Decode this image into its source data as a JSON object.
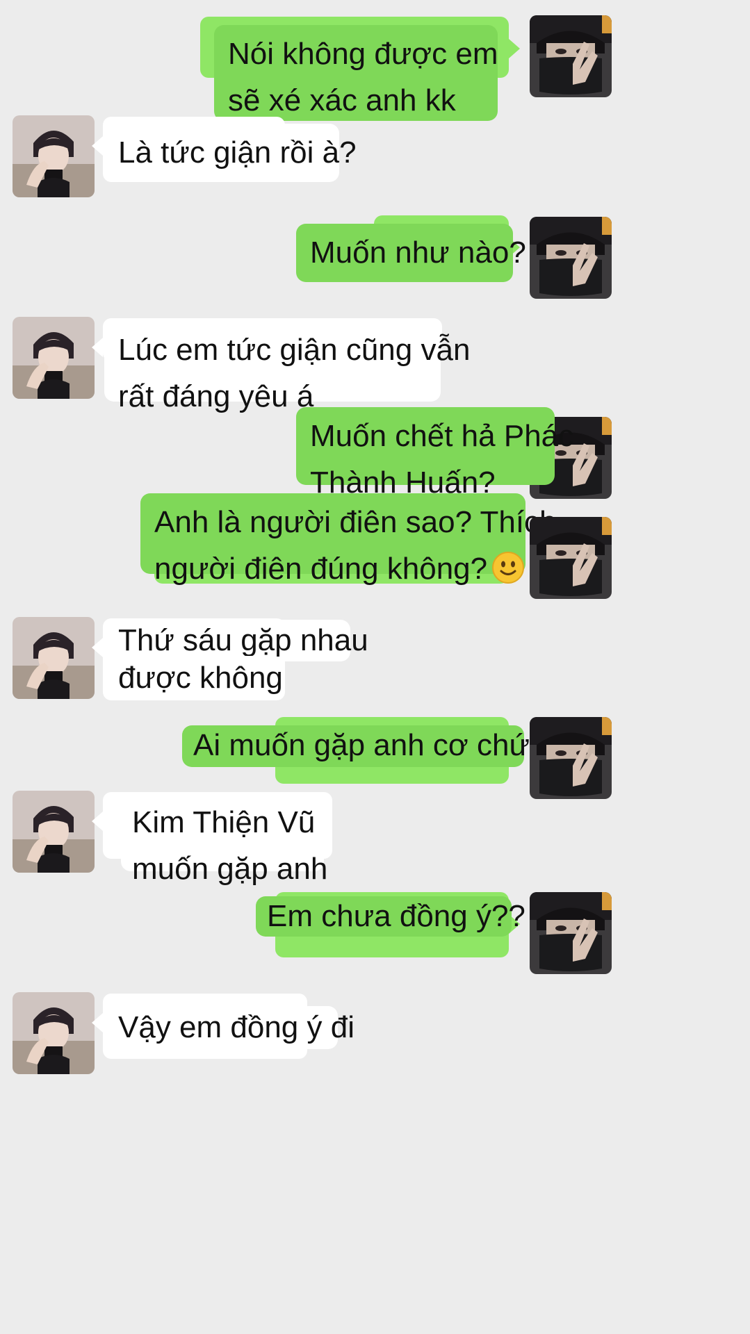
{
  "colors": {
    "background": "#ececec",
    "sent_bubble": "#7fd858",
    "sent_bubble_back": "#8fe665",
    "received_bubble": "#ffffff",
    "text": "#111111"
  },
  "messages": [
    {
      "side": "sent",
      "lines": [
        "Nói không được em",
        "sẽ xé xác anh kk"
      ]
    },
    {
      "side": "received",
      "lines": [
        "Là tức giận rồi à?"
      ]
    },
    {
      "side": "sent",
      "lines": [
        "Muốn như nào?"
      ]
    },
    {
      "side": "received",
      "lines": [
        "Lúc em tức giận cũng vẫn",
        "rất đáng yêu á"
      ]
    },
    {
      "side": "sent",
      "lines": [
        "Muốn chết hả Phác",
        "Thành Huấn?"
      ]
    },
    {
      "side": "sent",
      "lines": [
        "Anh là người điên sao? Thích",
        "người điên đúng không?"
      ],
      "emoji": "slightly-smiling-face-icon"
    },
    {
      "side": "received",
      "lines": [
        "Thứ sáu gặp nhau",
        "được không"
      ]
    },
    {
      "side": "sent",
      "lines": [
        "Ai muốn gặp anh cơ chứ?"
      ]
    },
    {
      "side": "received",
      "lines": [
        "Kim Thiện Vũ",
        "muốn gặp anh"
      ]
    },
    {
      "side": "sent",
      "lines": [
        "Em chưa đồng ý??"
      ]
    },
    {
      "side": "received",
      "lines": [
        "Vậy em đồng ý đi"
      ]
    }
  ]
}
